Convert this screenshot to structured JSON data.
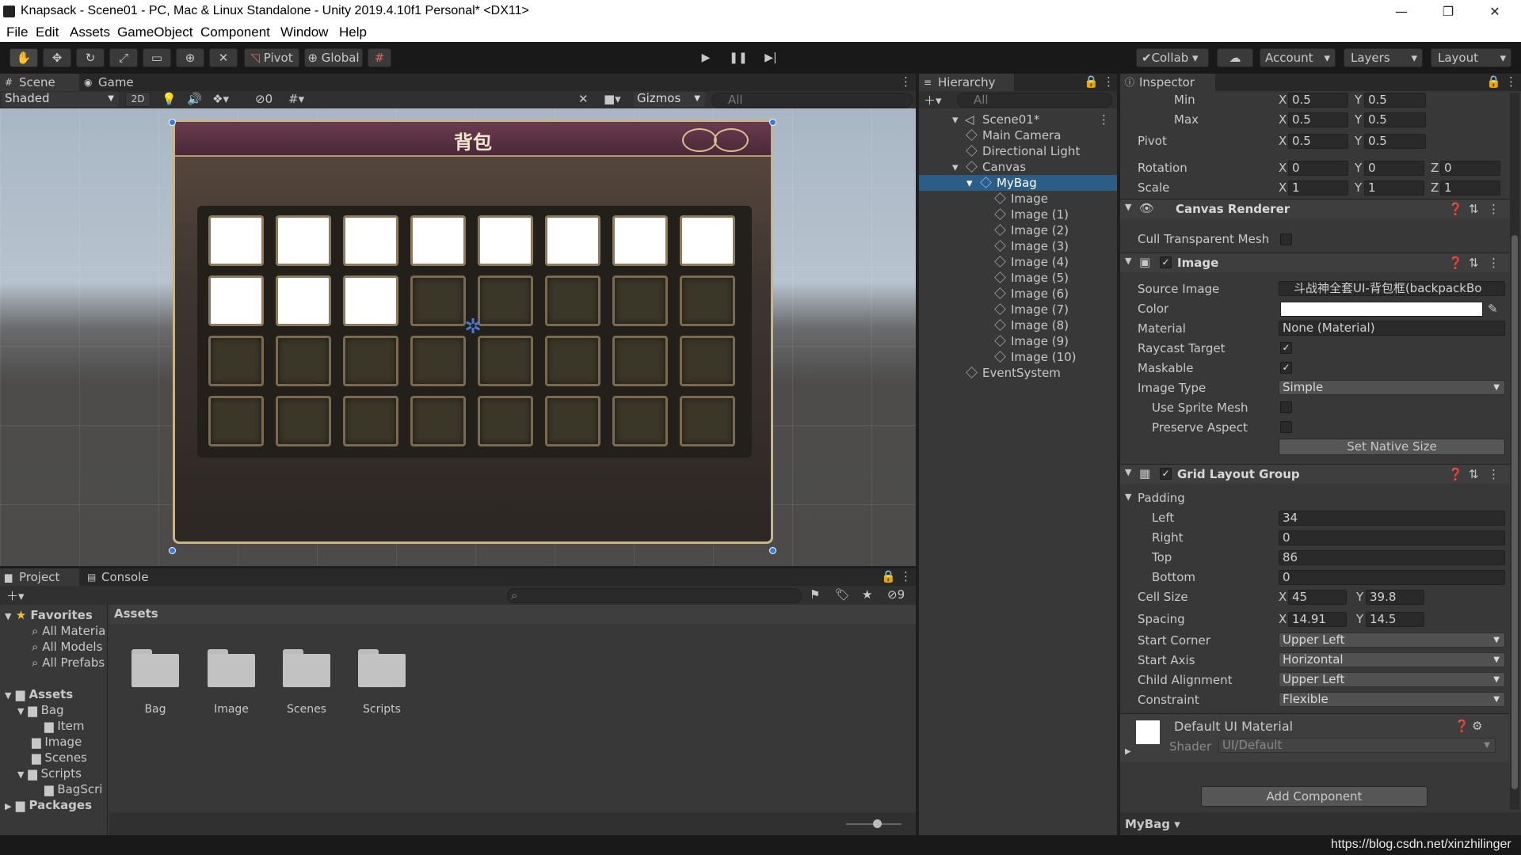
{
  "window": {
    "title": "Knapsack - Scene01 - PC, Mac & Linux Standalone - Unity 2019.4.10f1 Personal* <DX11>",
    "min": "—",
    "max": "❐",
    "close": "✕"
  },
  "menu": [
    "File",
    "Edit",
    "Assets",
    "GameObject",
    "Component",
    "Window",
    "Help"
  ],
  "toolbar": {
    "pivot": "Pivot",
    "global": "Global",
    "collab": "Collab",
    "account": "Account",
    "layers": "Layers",
    "layout": "Layout",
    "play": "▶",
    "pause": "❚❚",
    "step": "▶|"
  },
  "scene": {
    "tab_scene": "Scene",
    "tab_game": "Game",
    "shading": "Shaded",
    "mode2d": "2D",
    "hidden_count": "0",
    "gizmos": "Gizmos",
    "search_placeholder": "All",
    "bag_title": "背包",
    "white_slots": 11,
    "total_slots": 32
  },
  "hierarchy": {
    "tab": "Hierarchy",
    "search_placeholder": "All",
    "scene": "Scene01*",
    "items": [
      "Main Camera",
      "Directional Light",
      "Canvas",
      "MyBag",
      "Image",
      "Image (1)",
      "Image (2)",
      "Image (3)",
      "Image (4)",
      "Image (5)",
      "Image (6)",
      "Image (7)",
      "Image (8)",
      "Image (9)",
      "Image (10)",
      "EventSystem"
    ]
  },
  "inspector": {
    "tab": "Inspector",
    "anchors": {
      "min_label": "Min",
      "min_x": "0.5",
      "min_y": "0.5",
      "max_label": "Max",
      "max_x": "0.5",
      "max_y": "0.5",
      "pivot_label": "Pivot",
      "pivot_x": "0.5",
      "pivot_y": "0.5"
    },
    "rotation": {
      "label": "Rotation",
      "x": "0",
      "y": "0",
      "z": "0"
    },
    "scale": {
      "label": "Scale",
      "x": "1",
      "y": "1",
      "z": "1"
    },
    "canvas_renderer": {
      "title": "Canvas Renderer",
      "cull": "Cull Transparent Mesh"
    },
    "image": {
      "title": "Image",
      "source_label": "Source Image",
      "source_value": "斗战神全套UI-背包框(backpackBo",
      "color_label": "Color",
      "material_label": "Material",
      "material_value": "None (Material)",
      "raycast": "Raycast Target",
      "maskable": "Maskable",
      "type_label": "Image Type",
      "type_value": "Simple",
      "sprite_mesh": "Use Sprite Mesh",
      "preserve": "Preserve Aspect",
      "native": "Set Native Size"
    },
    "grid": {
      "title": "Grid Layout Group",
      "padding": "Padding",
      "left_label": "Left",
      "left": "34",
      "right_label": "Right",
      "right": "0",
      "top_label": "Top",
      "top": "86",
      "bottom_label": "Bottom",
      "bottom": "0",
      "cell_label": "Cell Size",
      "cell_x": "45",
      "cell_y": "39.8",
      "spacing_label": "Spacing",
      "spacing_x": "14.91",
      "spacing_y": "14.5",
      "corner_label": "Start Corner",
      "corner": "Upper Left",
      "axis_label": "Start Axis",
      "axis": "Horizontal",
      "align_label": "Child Alignment",
      "align": "Upper Left",
      "constraint_label": "Constraint",
      "constraint": "Flexible"
    },
    "material": {
      "name": "Default UI Material",
      "shader_label": "Shader",
      "shader": "UI/Default"
    },
    "add_component": "Add Component",
    "footer_object": "MyBag"
  },
  "project": {
    "tab_project": "Project",
    "tab_console": "Console",
    "hidden_count": "9",
    "favorites": "Favorites",
    "fav_items": [
      "All Materia",
      "All Models",
      "All Prefabs"
    ],
    "assets": "Assets",
    "tree": [
      "Bag",
      "Item",
      "Image",
      "Scenes",
      "Scripts",
      "BagScri",
      "Packages"
    ],
    "breadcrumb": "Assets",
    "folders": [
      "Bag",
      "Image",
      "Scenes",
      "Scripts"
    ]
  },
  "watermark": "https://blog.csdn.net/xinzhilinger"
}
